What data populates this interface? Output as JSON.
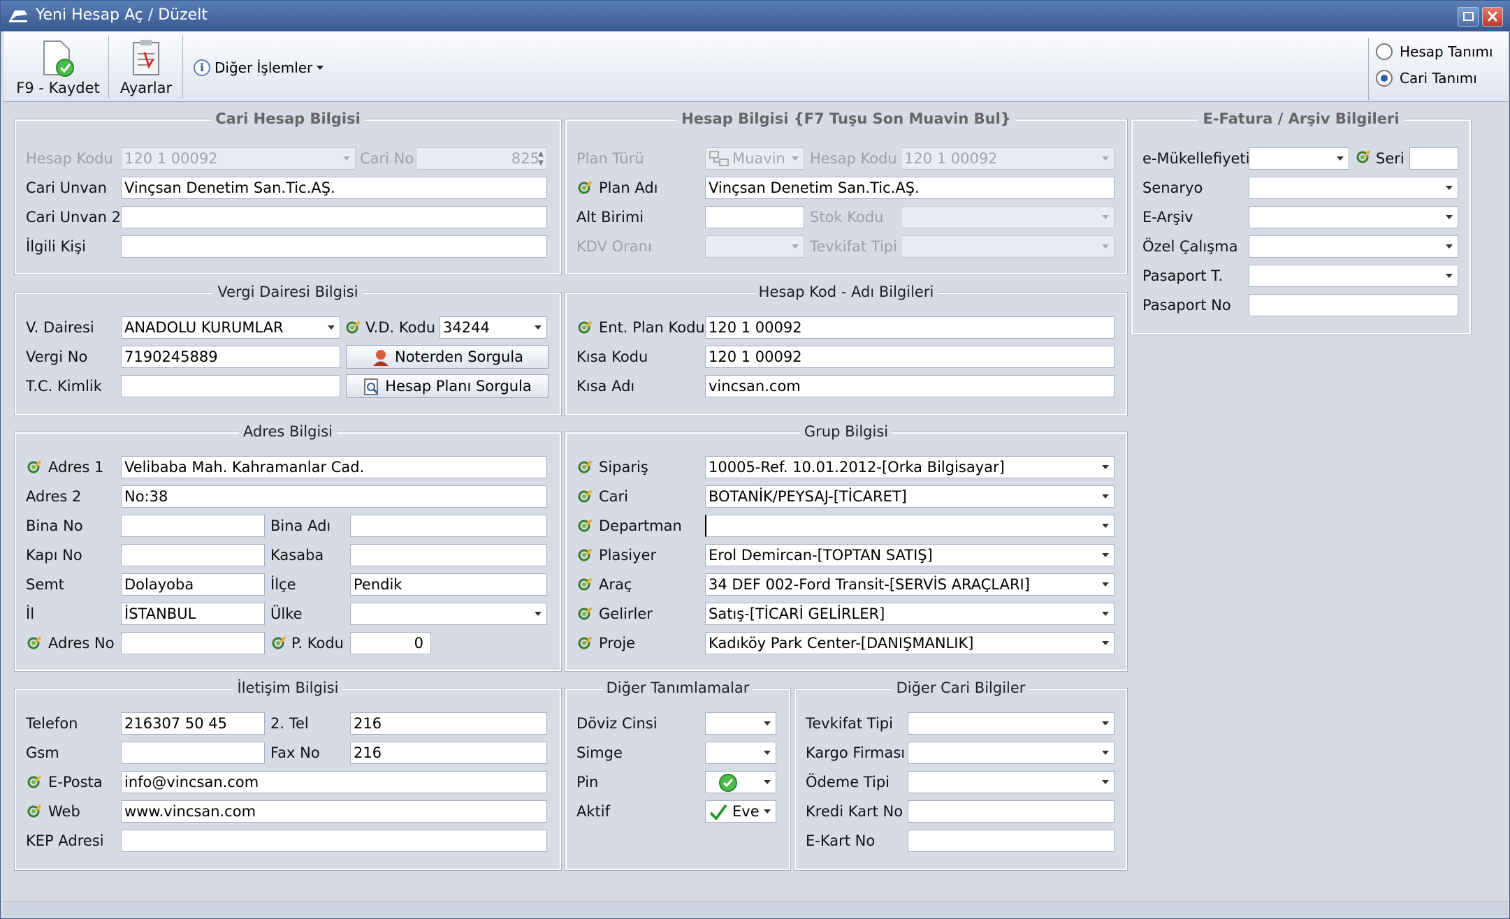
{
  "window": {
    "title": "Yeni Hesap Aç / Düzelt"
  },
  "toolbar": {
    "save_label": "F9 - Kaydet",
    "settings_label": "Ayarlar",
    "other_ops_label": "Diğer İşlemler",
    "radio_account": "Hesap Tanımı",
    "radio_cari": "Cari Tanımı",
    "selected": "Cari Tanımı"
  },
  "cari": {
    "title": "Cari Hesap Bilgisi",
    "hesap_kodu_label": "Hesap Kodu",
    "hesap_kodu": "120 1 00092",
    "cari_no_label": "Cari No",
    "cari_no": "825",
    "cari_unvan_label": "Cari Unvan",
    "cari_unvan": "Vinçsan Denetim San.Tic.AŞ.",
    "cari_unvan2_label": "Cari Unvan 2",
    "cari_unvan2": "",
    "ilgili_label": "İlgili Kişi",
    "ilgili": ""
  },
  "hesap": {
    "title": "Hesap Bilgisi {F7 Tuşu Son Muavin Bul}",
    "plan_turu_label": "Plan Türü",
    "plan_turu": "Muavin",
    "hesap_kodu_label": "Hesap Kodu",
    "hesap_kodu": "120 1 00092",
    "plan_adi_label": "Plan Adı",
    "plan_adi": "Vinçsan Denetim San.Tic.AŞ.",
    "alt_birimi_label": "Alt Birimi",
    "alt_birimi": "",
    "stok_kodu_label": "Stok Kodu",
    "kdv_label": "KDV Oranı",
    "tevkifat_label": "Tevkifat Tipi"
  },
  "efatura": {
    "title": "E-Fatura / Arşiv Bilgileri",
    "mukellef_label": "e-Mükellefiyeti",
    "seri_label": "Seri",
    "senaryo_label": "Senaryo",
    "earsiv_label": "E-Arşiv",
    "ozel_label": "Özel Çalışma",
    "pasaport_t_label": "Pasaport T.",
    "pasaport_no_label": "Pasaport No"
  },
  "vergi": {
    "title": "Vergi Dairesi Bilgisi",
    "daire_label": "V. Dairesi",
    "daire": "ANADOLU KURUMLAR",
    "vd_kodu_label": "V.D. Kodu",
    "vd_kodu": "34244",
    "vergi_no_label": "Vergi No",
    "vergi_no": "7190245889",
    "tc_label": "T.C. Kimlik",
    "tc": "",
    "noter_btn": "Noterden Sorgula",
    "plan_btn": "Hesap Planı Sorgula"
  },
  "hkod": {
    "title": "Hesap Kod - Adı Bilgileri",
    "ent_label": "Ent. Plan Kodu",
    "ent": "120 1 00092",
    "kisa_kodu_label": "Kısa Kodu",
    "kisa_kodu": "120 1 00092",
    "kisa_adi_label": "Kısa Adı",
    "kisa_adi": "vincsan.com"
  },
  "adres": {
    "title": "Adres Bilgisi",
    "adres1_label": "Adres 1",
    "adres1": "Velibaba Mah. Kahramanlar Cad.",
    "adres2_label": "Adres 2",
    "adres2": "No:38",
    "bina_no_label": "Bina No",
    "bina_adi_label": "Bina Adı",
    "kapi_label": "Kapı No",
    "kasaba_label": "Kasaba",
    "semt_label": "Semt",
    "semt": "Dolayoba",
    "ilce_label": "İlçe",
    "ilce": "Pendik",
    "il_label": "İl",
    "il": "İSTANBUL",
    "ulke_label": "Ülke",
    "adres_no_label": "Adres No",
    "pkodu_label": "P. Kodu",
    "pkodu": "0"
  },
  "grup": {
    "title": "Grup Bilgisi",
    "siparis_label": "Sipariş",
    "siparis": "10005-Ref. 10.01.2012-[Orka Bilgisayar]",
    "cari_label": "Cari",
    "cari": "BOTANİK/PEYSAJ-[TİCARET]",
    "departman_label": "Departman",
    "departman": "",
    "plasiyer_label": "Plasiyer",
    "plasiyer": "Erol Demircan-[TOPTAN SATIŞ]",
    "arac_label": "Araç",
    "arac": "34 DEF 002-Ford Transit-[SERVİS ARAÇLARI]",
    "gelirler_label": "Gelirler",
    "gelirler": "Satış-[TİCARİ GELİRLER]",
    "proje_label": "Proje",
    "proje": "Kadıköy Park Center-[DANIŞMANLIK]"
  },
  "iletisim": {
    "title": "İletişim Bilgisi",
    "telefon_label": "Telefon",
    "telefon": "216307 50 45",
    "tel2_label": "2. Tel",
    "tel2": "216",
    "gsm_label": "Gsm",
    "fax_label": "Fax No",
    "fax": "216",
    "eposta_label": "E-Posta",
    "eposta": "info@vincsan.com",
    "web_label": "Web",
    "web": "www.vincsan.com",
    "kep_label": "KEP Adresi"
  },
  "diger": {
    "title": "Diğer Tanımlamalar",
    "doviz_label": "Döviz Cinsi",
    "simge_label": "Simge",
    "pin_label": "Pin",
    "aktif_label": "Aktif",
    "aktif": "Eve"
  },
  "dcari": {
    "title": "Diğer Cari Bilgiler",
    "tevkifat_label": "Tevkifat Tipi",
    "kargo_label": "Kargo Firması",
    "odeme_label": "Ödeme Tipi",
    "kredi_label": "Kredi Kart No",
    "ekart_label": "E-Kart No"
  }
}
